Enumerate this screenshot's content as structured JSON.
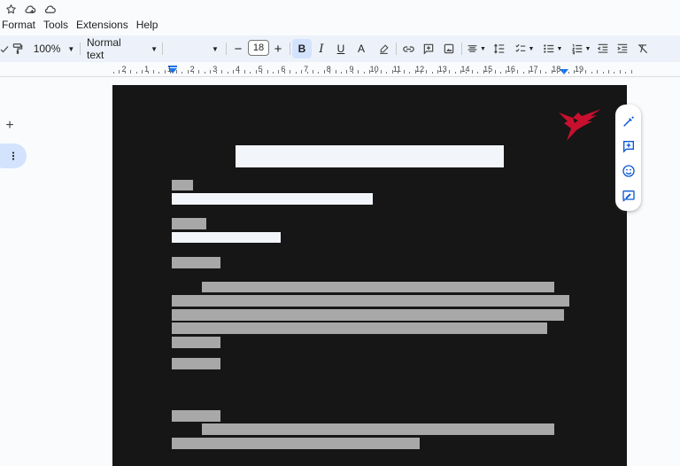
{
  "menu": {
    "items": [
      "Format",
      "Tools",
      "Extensions",
      "Help"
    ]
  },
  "toolbar": {
    "zoom": "100%",
    "style": "Normal text",
    "font_size": "18",
    "minus": "−",
    "plus": "+",
    "bold": "B",
    "italic": "I",
    "underline": "U",
    "text_color": "A"
  },
  "ruler": {
    "numbers": [
      "2",
      "1",
      "1",
      "2",
      "3",
      "4",
      "5",
      "6",
      "7",
      "8",
      "9",
      "10",
      "11",
      "12",
      "13",
      "14",
      "15",
      "16",
      "17",
      "18",
      "19"
    ]
  },
  "left": {
    "plus": "+"
  },
  "colors": {
    "accent": "#1a73e8",
    "logo": "#c8102e",
    "page_bg": "#161616",
    "redaction": "#a8a8a8"
  },
  "side_panel": {
    "icons": [
      "magic-pencil-icon",
      "add-comment-icon",
      "emoji-icon",
      "suggest-edits-icon"
    ]
  }
}
